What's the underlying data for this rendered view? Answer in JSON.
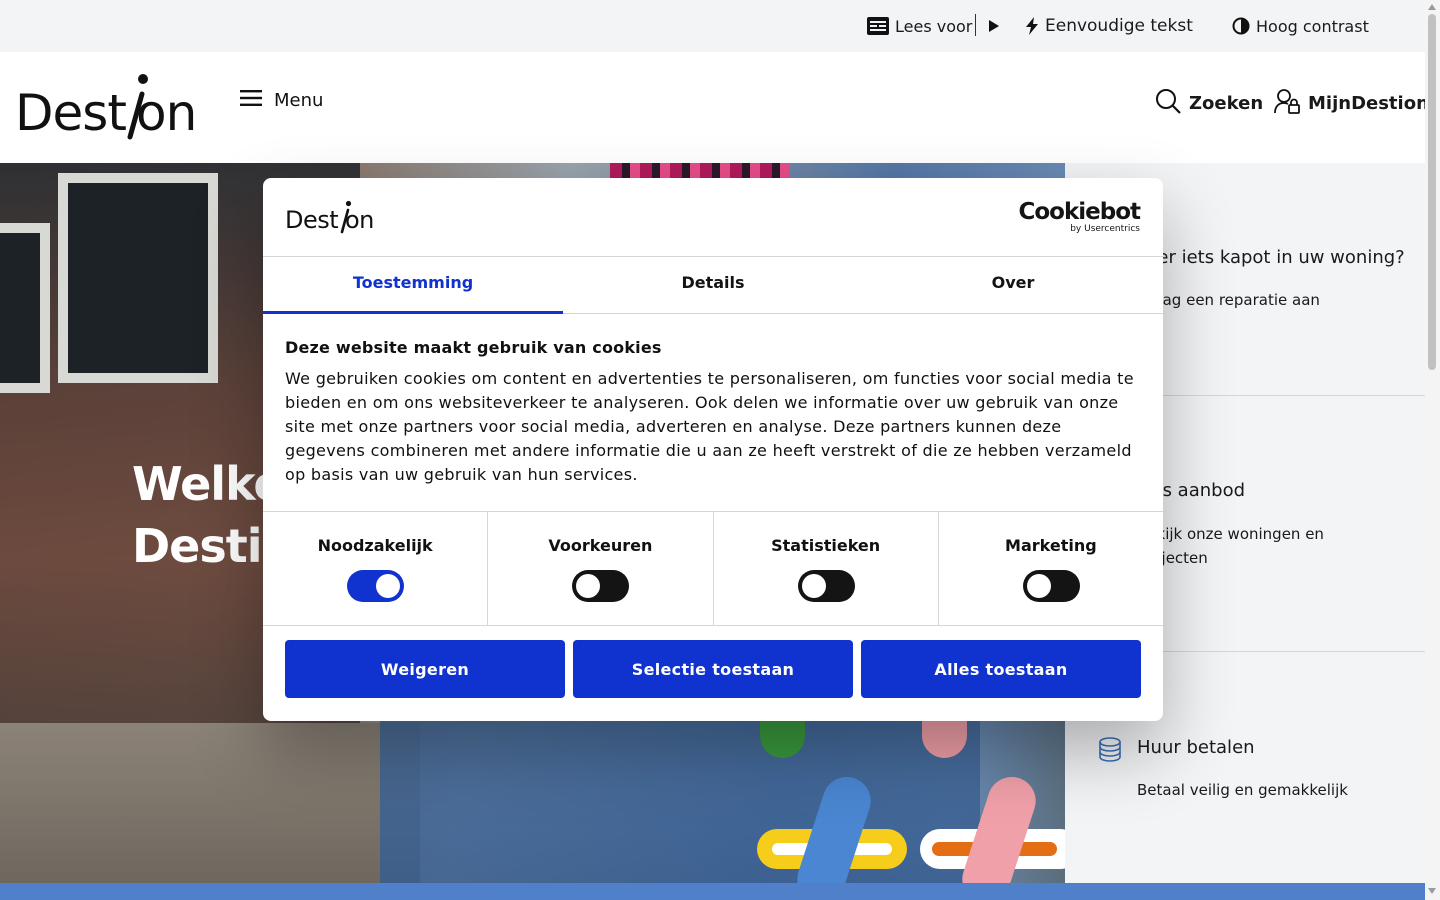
{
  "topbar": {
    "read_aloud": "Lees voor",
    "simple_text": "Eenvoudige tekst",
    "high_contrast": "Hoog contrast"
  },
  "header": {
    "logo_text": "Destion",
    "menu_label": "Menu",
    "search_label": "Zoeken",
    "account_label": "MijnDestion"
  },
  "hero": {
    "title_line1": "Welkom bij",
    "title_line2": "Destion"
  },
  "side_links": [
    {
      "title": "Is er iets kapot in uw woning?",
      "desc": "Vraag een reparatie aan",
      "icon": "tools-icon"
    },
    {
      "title": "Ons aanbod",
      "desc": "Bekijk onze woningen en projecten",
      "icon": "house-icon"
    },
    {
      "title": "Huur betalen",
      "desc": "Betaal veilig en gemakkelijk",
      "icon": "coins-icon"
    }
  ],
  "cookie": {
    "logo_text": "Destion",
    "brand_name": "Cookiebot",
    "brand_sub": "by Usercentrics",
    "tabs": [
      "Toestemming",
      "Details",
      "Over"
    ],
    "heading": "Deze website maakt gebruik van cookies",
    "body": "We gebruiken cookies om content en advertenties te personaliseren, om functies voor social media te bieden en om ons websiteverkeer te analyseren. Ook delen we informatie over uw gebruik van onze site met onze partners voor social media, adverteren en analyse. Deze partners kunnen deze gegevens combineren met andere informatie die u aan ze heeft verstrekt of die ze hebben verzameld op basis van uw gebruik van hun services.",
    "categories": [
      {
        "label": "Noodzakelijk",
        "enabled": true
      },
      {
        "label": "Voorkeuren",
        "enabled": false
      },
      {
        "label": "Statistieken",
        "enabled": false
      },
      {
        "label": "Marketing",
        "enabled": false
      }
    ],
    "buttons": {
      "deny": "Weigeren",
      "selection": "Selectie toestaan",
      "allow_all": "Alles toestaan"
    }
  },
  "colors": {
    "primary_blue": "#1032cf",
    "band_blue": "#4f80c9",
    "panel_grey": "#f3f4f6"
  }
}
